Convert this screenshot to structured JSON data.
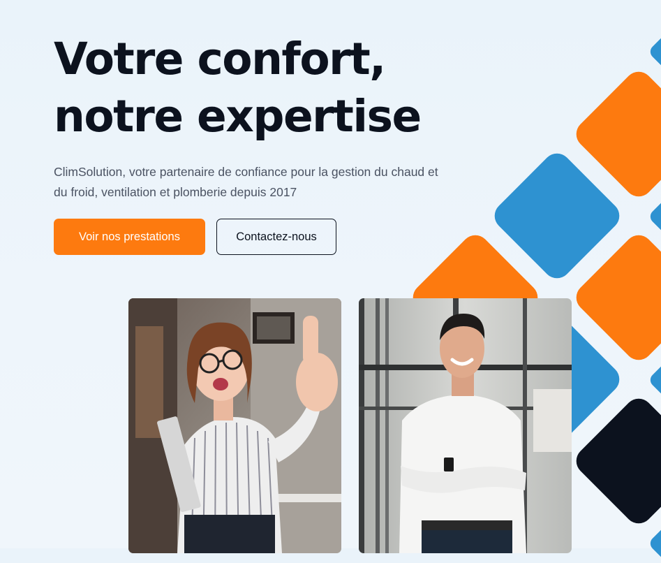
{
  "hero": {
    "title_line_1": "Votre confort,",
    "title_line_2": "notre expertise",
    "subtitle": "ClimSolution, votre partenaire de confiance pour la gestion du chaud et du froid, ventilation et plomberie depuis 2017"
  },
  "buttons": {
    "primary_label": "Voir nos prestations",
    "secondary_label": "Contactez-nous"
  },
  "photos": [
    {
      "subject": "woman-thumbs-up"
    },
    {
      "subject": "man-arms-crossed"
    }
  ],
  "colors": {
    "orange": "#fd7a0f",
    "blue": "#2e92d1",
    "dark": "#0c121e",
    "text": "#0c121e",
    "muted": "#4a5262"
  }
}
